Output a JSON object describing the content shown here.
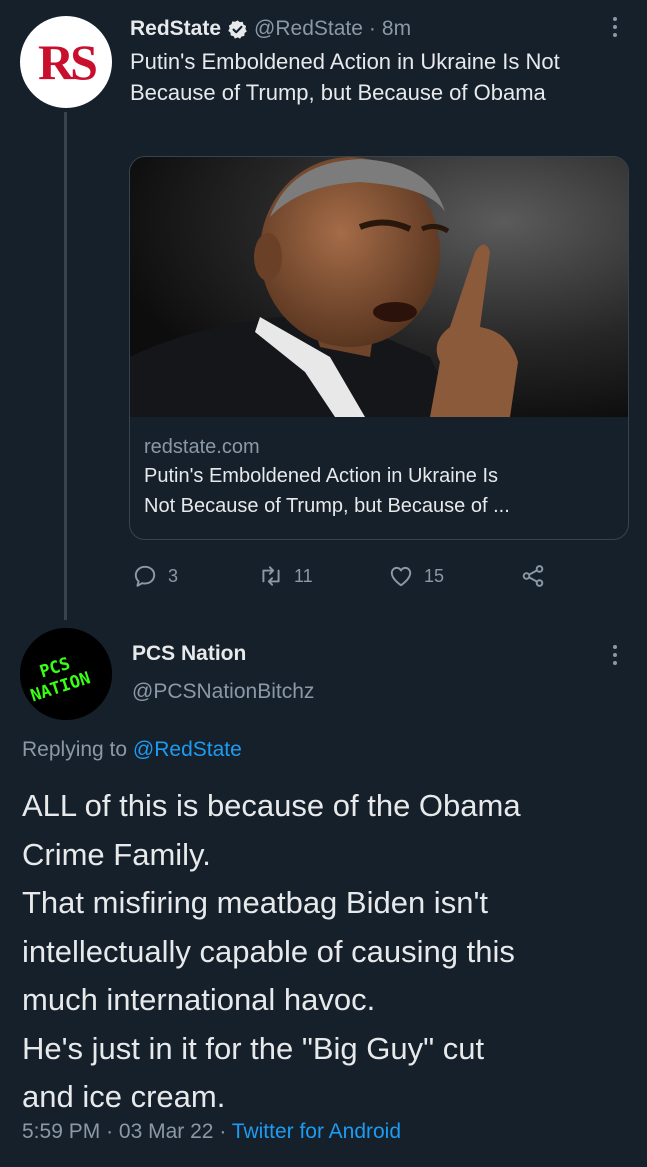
{
  "parent_tweet": {
    "avatar_text": "RS",
    "name": "RedState",
    "handle": "@RedState",
    "separator": "·",
    "time": "8m",
    "text": "Putin's Emboldened Action in Ukraine Is Not Because of Trump, but Because of Obama",
    "card": {
      "domain": "redstate.com",
      "title_line1": "Putin's Emboldened Action in Ukraine Is",
      "title_line2": "Not Because of Trump, but Because of ..."
    },
    "actions": {
      "replies": "3",
      "retweets": "11",
      "likes": "15"
    }
  },
  "reply_tweet": {
    "avatar_text_line1": "PCS",
    "avatar_text_line2": "NATION",
    "name": "PCS Nation",
    "handle": "@PCSNationBitchz",
    "replying_prefix": "Replying to",
    "replying_to": "@RedState",
    "text_lines": [
      "ALL of this is because of the Obama",
      "Crime Family.",
      "That misfiring meatbag Biden isn't",
      "intellectually capable of causing this",
      "much international havoc.",
      "He's just in it for the \"Big Guy\" cut",
      "and ice cream."
    ],
    "time": "5:59 PM",
    "date": "03 Mar 22",
    "separator": "·",
    "source": "Twitter for Android"
  },
  "colors": {
    "background": "#15202b",
    "text": "#e7e9ea",
    "muted": "#8b98a5",
    "accent": "#1d9bf0",
    "border": "#38444d",
    "brand_red": "#c8102e",
    "neon_green": "#39ff14"
  },
  "icons": [
    "verified-badge-icon",
    "more-icon",
    "reply-icon",
    "retweet-icon",
    "like-icon",
    "share-icon"
  ]
}
